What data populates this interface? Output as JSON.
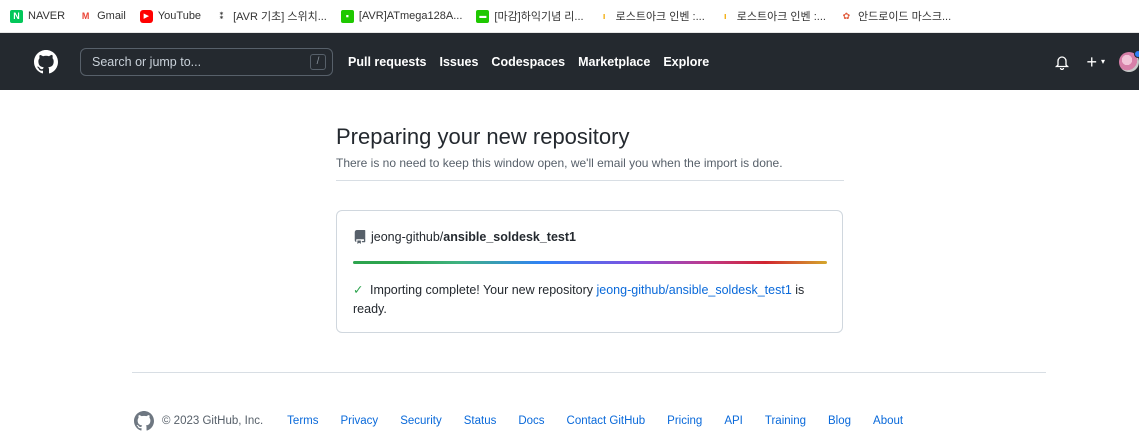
{
  "bookmarks": [
    {
      "label": "NAVER",
      "icon": "naver-icon",
      "color": "#03c75a",
      "glyph": "N"
    },
    {
      "label": "Gmail",
      "icon": "gmail-icon",
      "color": "#ea4335",
      "glyph": "M"
    },
    {
      "label": "YouTube",
      "icon": "youtube-icon",
      "color": "#ff0000",
      "glyph": "▶"
    },
    {
      "label": "[AVR 기초] 스위치...",
      "icon": "dots-icon",
      "color": "#333333",
      "glyph": "⁑"
    },
    {
      "label": "[AVR]ATmega128A...",
      "icon": "square-icon",
      "color": "#1ec800",
      "glyph": "▪"
    },
    {
      "label": "[마감]하익기념 리...",
      "icon": "blog-icon",
      "color": "#1ec800",
      "glyph": "▬"
    },
    {
      "label": "로스트아크 인벤 :...",
      "icon": "inven-icon",
      "color": "#f2a900",
      "glyph": "ı"
    },
    {
      "label": "로스트아크 인벤 :...",
      "icon": "inven-icon",
      "color": "#f2a900",
      "glyph": "ı"
    },
    {
      "label": "안드로이드 마스크...",
      "icon": "leaf-icon",
      "color": "#e05a3a",
      "glyph": "✿"
    }
  ],
  "header": {
    "search_placeholder": "Search or jump to...",
    "search_shortcut": "/",
    "nav": [
      "Pull requests",
      "Issues",
      "Codespaces",
      "Marketplace",
      "Explore"
    ],
    "plus_label": "+",
    "caret_label": "▾"
  },
  "main": {
    "title": "Preparing your new repository",
    "subtitle": "There is no need to keep this window open, we'll email you when the import is done.",
    "repo_owner": "jeong-github/",
    "repo_name": "ansible_soldesk_test1",
    "progress": 1.0,
    "check": "✓",
    "status_text": "Importing complete! Your new repository",
    "status_link": "jeong-github/ansible_soldesk_test1",
    "status_suffix": "is ready."
  },
  "footer": {
    "copyright": "© 2023 GitHub, Inc.",
    "links": [
      "Terms",
      "Privacy",
      "Security",
      "Status",
      "Docs",
      "Contact GitHub",
      "Pricing",
      "API",
      "Training",
      "Blog",
      "About"
    ]
  },
  "colors": {
    "header_bg": "#24292f",
    "link": "#0969da",
    "success": "#2da44e"
  }
}
